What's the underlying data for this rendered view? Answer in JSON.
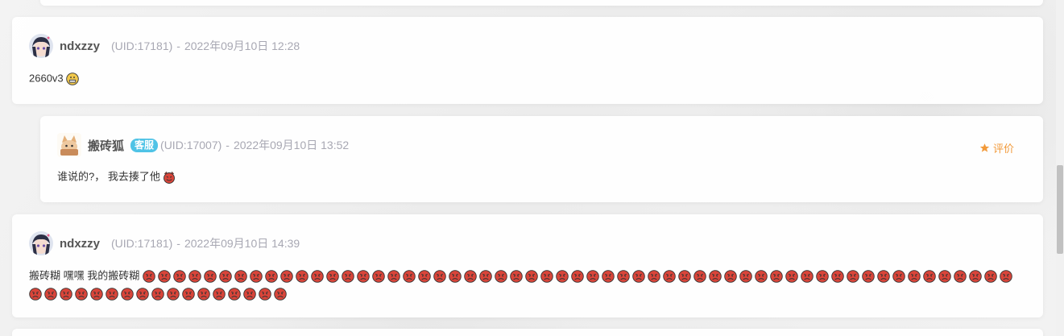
{
  "comments": [
    {
      "username": "ndxzzy",
      "uid": "(UID:17181)",
      "separator": "-",
      "time": "2022年09月10日 12:28",
      "text": "2660v3"
    },
    {
      "username": "搬砖狐",
      "badge": "客服",
      "uid": "(UID:17007)",
      "separator": "-",
      "time": "2022年09月10日 13:52",
      "text": "谁说的?， 我去揍了他",
      "rate_label": "评价"
    },
    {
      "username": "ndxzzy",
      "uid": "(UID:17181)",
      "separator": "-",
      "time": "2022年09月10日 14:39",
      "text": "搬砖糊 嘿嘿 我的搬砖糊",
      "repeat_emoji": "angry-face-emoji",
      "repeat_count": 74
    }
  ],
  "colors": {
    "badge": "#4fc3e6",
    "rate": "#f29a3a",
    "meta": "#a8a8b3"
  }
}
